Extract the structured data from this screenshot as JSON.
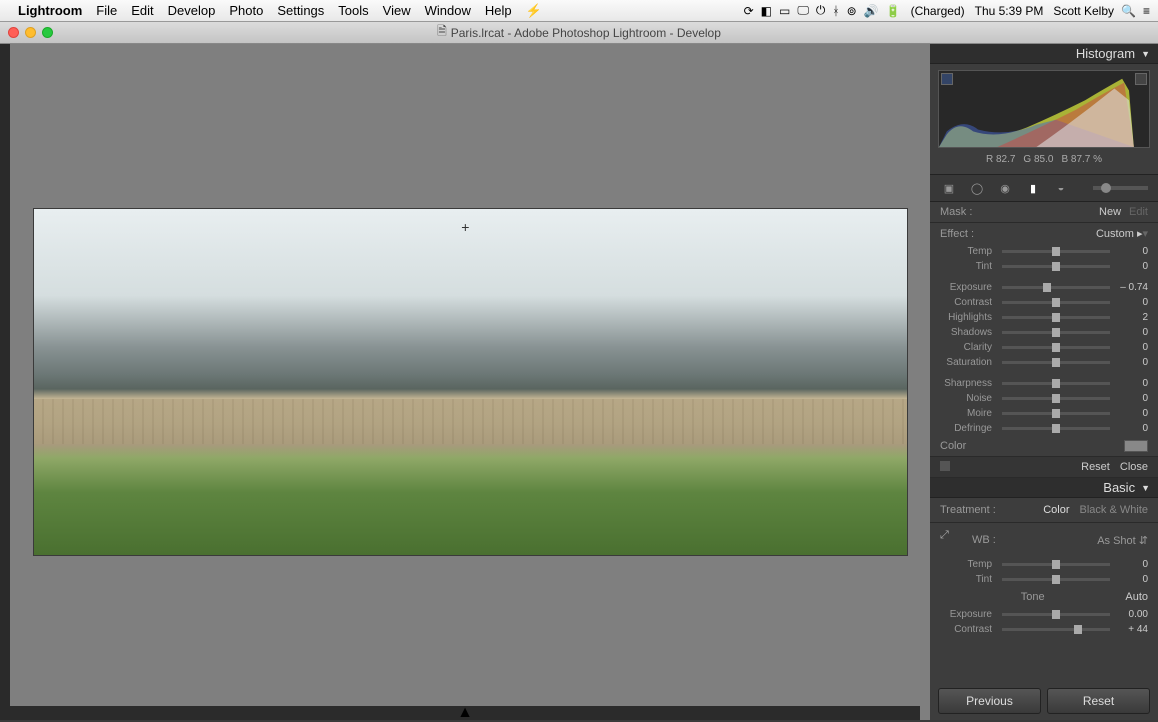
{
  "menubar": {
    "app": "Lightroom",
    "items": [
      "File",
      "Edit",
      "Develop",
      "Photo",
      "Settings",
      "Tools",
      "View",
      "Window",
      "Help"
    ],
    "battery": "(Charged)",
    "clock": "Thu 5:39 PM",
    "user": "Scott Kelby"
  },
  "window": {
    "title": "Paris.lrcat - Adobe Photoshop Lightroom - Develop"
  },
  "panel": {
    "histogram_title": "Histogram",
    "rgb": {
      "r_label": "R",
      "r": "82.7",
      "g_label": "G",
      "g": "85.0",
      "b_label": "B",
      "b": "87.7",
      "pct": "%"
    },
    "mask": {
      "label": "Mask :",
      "new": "New",
      "edit": "Edit"
    },
    "effect": {
      "label": "Effect :",
      "value": "Custom"
    },
    "sliders_grad": [
      {
        "label": "Temp",
        "val": "0",
        "pos": 50
      },
      {
        "label": "Tint",
        "val": "0",
        "pos": 50
      },
      {
        "label": "Exposure",
        "val": "– 0.74",
        "pos": 42
      },
      {
        "label": "Contrast",
        "val": "0",
        "pos": 50
      },
      {
        "label": "Highlights",
        "val": "2",
        "pos": 50
      },
      {
        "label": "Shadows",
        "val": "0",
        "pos": 50
      },
      {
        "label": "Clarity",
        "val": "0",
        "pos": 50
      },
      {
        "label": "Saturation",
        "val": "0",
        "pos": 50
      },
      {
        "label": "Sharpness",
        "val": "0",
        "pos": 50
      },
      {
        "label": "Noise",
        "val": "0",
        "pos": 50
      },
      {
        "label": "Moire",
        "val": "0",
        "pos": 50
      },
      {
        "label": "Defringe",
        "val": "0",
        "pos": 50
      }
    ],
    "color_label": "Color",
    "reset": "Reset",
    "close": "Close",
    "basic_title": "Basic",
    "treatment": {
      "label": "Treatment :",
      "color": "Color",
      "bw": "Black & White"
    },
    "wb": {
      "label": "WB :",
      "value": "As Shot"
    },
    "sliders_basic_wb": [
      {
        "label": "Temp",
        "val": "0",
        "pos": 50
      },
      {
        "label": "Tint",
        "val": "0",
        "pos": 50
      }
    ],
    "tone": {
      "label": "Tone",
      "auto": "Auto"
    },
    "sliders_basic_tone": [
      {
        "label": "Exposure",
        "val": "0.00",
        "pos": 50
      },
      {
        "label": "Contrast",
        "val": "+ 44",
        "pos": 70
      }
    ],
    "prev": "Previous",
    "reset2": "Reset"
  }
}
